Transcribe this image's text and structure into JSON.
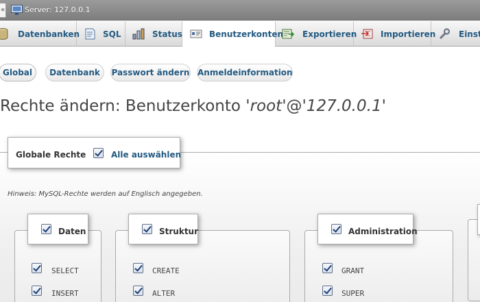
{
  "serverbar": {
    "collapse_label": "«",
    "title": "Server: 127.0.0.1"
  },
  "topmenu": {
    "tabs": [
      {
        "label": "Datenbanken",
        "icon": "database-icon"
      },
      {
        "label": "SQL",
        "icon": "sql-icon"
      },
      {
        "label": "Status",
        "icon": "status-icon"
      },
      {
        "label": "Benutzerkonten",
        "icon": "user-accounts-icon",
        "active": true
      },
      {
        "label": "Exportieren",
        "icon": "export-icon"
      },
      {
        "label": "Importieren",
        "icon": "import-icon"
      },
      {
        "label": "Einst",
        "icon": "settings-icon"
      }
    ]
  },
  "subtabs": [
    {
      "label": "Global",
      "active": true
    },
    {
      "label": "Datenbank"
    },
    {
      "label": "Passwort ändern"
    },
    {
      "label": "Anmeldeinformation"
    }
  ],
  "page": {
    "title_prefix": "Rechte ändern: Benutzerkonto ",
    "user": "'root'",
    "at": "@",
    "host": "'127.0.0.1'"
  },
  "global_privileges": {
    "legend": "Globale Rechte",
    "select_all_label": "Alle auswählen",
    "select_all_checked": true,
    "hint": "Hinweis: MySQL-Rechte werden auf Englisch angegeben."
  },
  "groups": [
    {
      "legend": "Daten",
      "checked": true,
      "privileges": [
        {
          "name": "SELECT",
          "checked": true
        },
        {
          "name": "INSERT",
          "checked": true
        }
      ]
    },
    {
      "legend": "Struktur",
      "checked": true,
      "privileges": [
        {
          "name": "CREATE",
          "checked": true
        },
        {
          "name": "ALTER",
          "checked": true
        }
      ]
    },
    {
      "legend": "Administration",
      "checked": true,
      "privileges": [
        {
          "name": "GRANT",
          "checked": true
        },
        {
          "name": "SUPER",
          "checked": true
        }
      ]
    }
  ],
  "colors": {
    "link": "#235a81",
    "text": "#333333",
    "checkmark": "#1b3f77"
  }
}
